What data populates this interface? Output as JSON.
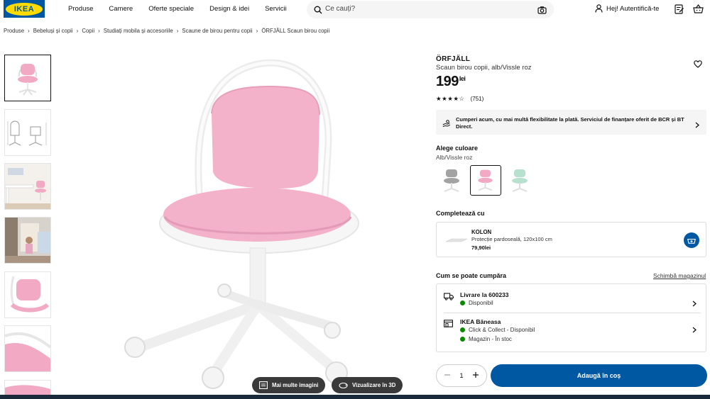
{
  "brand": {
    "logo_text": "IKEA",
    "blue": "#0058a3",
    "yellow": "#ffdb00"
  },
  "nav": {
    "items": [
      "Produse",
      "Camere",
      "Oferte speciale",
      "Design & idei",
      "Servicii"
    ]
  },
  "search": {
    "placeholder": "Ce cauți?"
  },
  "account": {
    "label": "Hej! Autentifică-te"
  },
  "breadcrumb": [
    "Produse",
    "Bebeluși și copii",
    "Copii",
    "Studiați mobila și accesoriile",
    "Scaune de birou pentru copii",
    "ÖRFJÄLL Scaun birou copii"
  ],
  "gallery": {
    "more_images_label": "Mai multe imagini",
    "view_3d_label": "Vizualizare în 3D"
  },
  "product": {
    "name": "ÖRFJÄLL",
    "description": "Scaun birou copii, alb/Vissle roz",
    "price": "199",
    "currency": "lei",
    "rating_stars": 4,
    "rating_stars_text": "★★★★☆",
    "review_count": "(751)"
  },
  "finance": {
    "text": "Cumperi acum, cu mai multă flexibilitate la plată. Serviciul de finanțare oferit de BCR și BT Direct."
  },
  "color": {
    "heading": "Alege culoare",
    "selected": "Alb/Vissle roz",
    "options": [
      "gri",
      "roz",
      "verde"
    ],
    "option_colors": [
      "#9a9a9a",
      "#f0aec6",
      "#b8e0cf"
    ]
  },
  "complete": {
    "heading": "Completează cu",
    "item_name": "KOLON",
    "item_desc": "Protecție pardoseală, 120x100 cm",
    "item_price": "79,90lei"
  },
  "purchase": {
    "heading": "Cum se poate cumpăra",
    "change_store": "Schimbă magazinul",
    "delivery_title": "Livrare la 600233",
    "delivery_status": "Disponibil",
    "store_title": "IKEA Băneasa",
    "store_click": "Click & Collect - Disponibil",
    "store_stock": "Magazin - În stoc"
  },
  "cart": {
    "quantity": "1",
    "add_label": "Adaugă în coș"
  }
}
